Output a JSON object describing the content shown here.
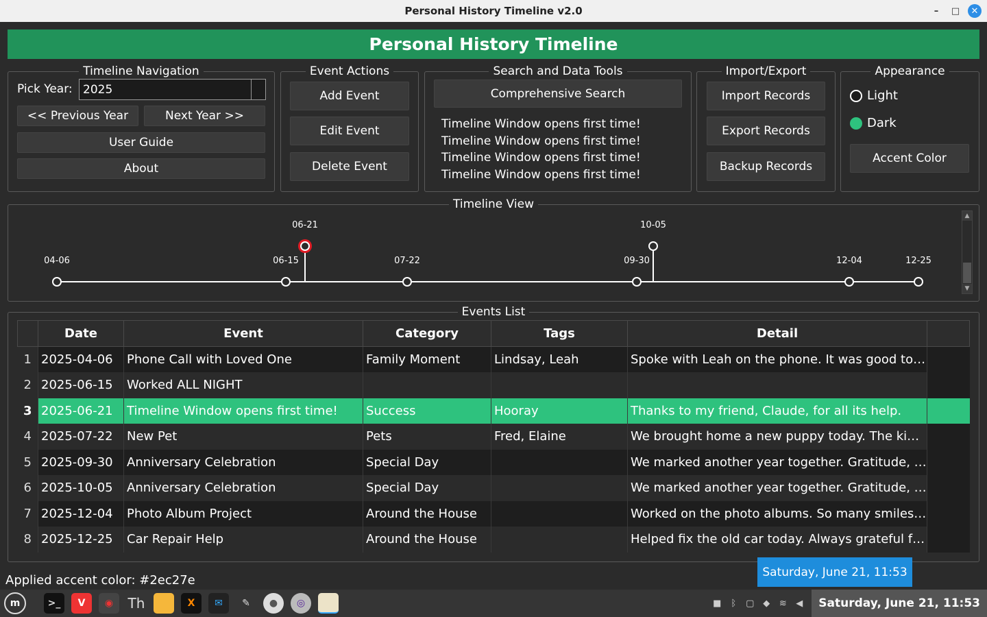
{
  "window": {
    "title": "Personal History Timeline v2.0",
    "minimize": "–",
    "maximize": "□",
    "close": "✕"
  },
  "banner": {
    "title": "Personal History Timeline"
  },
  "navigation": {
    "legend": "Timeline Navigation",
    "pick_year_label": "Pick Year:",
    "year_value": "2025",
    "prev_label": "<< Previous Year",
    "next_label": "Next Year >>",
    "guide_label": "User Guide",
    "about_label": "About"
  },
  "event_actions": {
    "legend": "Event Actions",
    "add": "Add Event",
    "edit": "Edit Event",
    "delete": "Delete Event"
  },
  "search_tools": {
    "legend": "Search and Data Tools",
    "search_button": "Comprehensive Search",
    "messages": [
      "Timeline Window opens first time!",
      "Timeline Window opens first time!",
      "Timeline Window opens first time!",
      "Timeline Window opens first time!"
    ]
  },
  "import_export": {
    "legend": "Import/Export",
    "import": "Import Records",
    "export": "Export Records",
    "backup": "Backup Records"
  },
  "appearance": {
    "legend": "Appearance",
    "light": "Light",
    "dark": "Dark",
    "selected": "Dark",
    "accent_button": "Accent Color"
  },
  "timeline_view": {
    "legend": "Timeline View",
    "points": [
      {
        "label": "04-06",
        "level": "base"
      },
      {
        "label": "06-15",
        "level": "base"
      },
      {
        "label": "06-21",
        "level": "raised",
        "selected": true
      },
      {
        "label": "07-22",
        "level": "base"
      },
      {
        "label": "09-30",
        "level": "base"
      },
      {
        "label": "10-05",
        "level": "raised"
      },
      {
        "label": "12-04",
        "level": "base"
      },
      {
        "label": "12-25",
        "level": "base"
      }
    ]
  },
  "events_list": {
    "legend": "Events List",
    "columns": [
      "Date",
      "Event",
      "Category",
      "Tags",
      "Detail"
    ],
    "rows": [
      {
        "n": "1",
        "date": "2025-04-06",
        "event": "Phone Call with Loved One",
        "category": "Family Moment",
        "tags": "Lindsay, Leah",
        "detail": "Spoke with Leah on the phone. It was good to h..."
      },
      {
        "n": "2",
        "date": "2025-06-15",
        "event": "Worked ALL NIGHT",
        "category": "",
        "tags": "",
        "detail": ""
      },
      {
        "n": "3",
        "date": "2025-06-21",
        "event": "Timeline Window opens first time!",
        "category": "Success",
        "tags": "Hooray",
        "detail": "Thanks to my friend, Claude, for all its help.",
        "selected": true
      },
      {
        "n": "4",
        "date": "2025-07-22",
        "event": "New Pet",
        "category": "Pets",
        "tags": "Fred, Elaine",
        "detail": "We brought home a new puppy today. The kids ..."
      },
      {
        "n": "5",
        "date": "2025-09-30",
        "event": "Anniversary Celebration",
        "category": "Special Day",
        "tags": "",
        "detail": "We marked another year together. Gratitude, lo..."
      },
      {
        "n": "6",
        "date": "2025-10-05",
        "event": "Anniversary Celebration",
        "category": "Special Day",
        "tags": "",
        "detail": "We marked another year together. Gratitude, lo..."
      },
      {
        "n": "7",
        "date": "2025-12-04",
        "event": "Photo Album Project",
        "category": "Around the House",
        "tags": "",
        "detail": "Worked on the photo albums. So many smiles, s..."
      },
      {
        "n": "8",
        "date": "2025-12-25",
        "event": "Car Repair Help",
        "category": "Around the House",
        "tags": "",
        "detail": "Helped fix the old car today. Always grateful for ..."
      }
    ]
  },
  "status": {
    "text": "Applied accent color: #2ec27e"
  },
  "tooltip": {
    "text": "Saturday, June 21, 11:53"
  },
  "taskbar": {
    "clock": "Saturday, June 21, 11:53"
  },
  "colors": {
    "accent": "#2ec27e",
    "banner": "#21935a",
    "selected_marker": "#e01b24",
    "tooltip": "#1e8ddc"
  }
}
